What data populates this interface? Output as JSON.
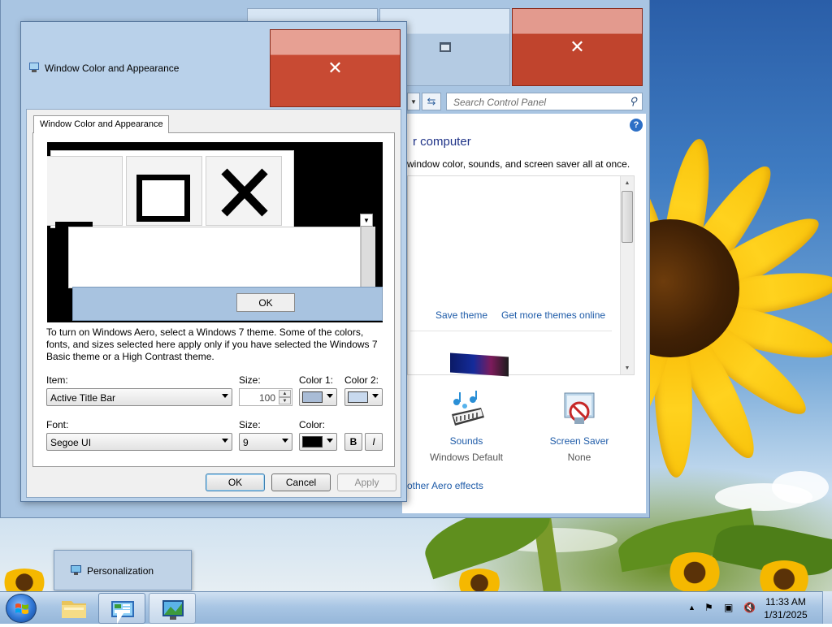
{
  "control_panel": {
    "search_placeholder": "Search Control Panel",
    "heading": "r computer",
    "description": "window color, sounds, and screen saver all at once.",
    "save_theme": "Save theme",
    "more_themes": "Get more themes online",
    "sounds_label": "Sounds",
    "sounds_value": "Windows Default",
    "screensaver_label": "Screen Saver",
    "screensaver_value": "None",
    "aero_link": "other Aero effects",
    "help": "?"
  },
  "dialog": {
    "title": "Window Color and Appearance",
    "tab": "Window Color and Appearance",
    "preview_ok": "OK",
    "info_text": "To turn on Windows Aero, select a Windows 7 theme.  Some of the colors, fonts, and sizes selected here apply only if you have selected the Windows 7 Basic theme or a High Contrast theme.",
    "item_label": "Item:",
    "item_value": "Active Title Bar",
    "size_label": "Size:",
    "size_value": "100",
    "color1_label": "Color 1:",
    "color1": "#a9bcd6",
    "color2_label": "Color 2:",
    "color2": "#c8d9ee",
    "font_label": "Font:",
    "font_value": "Segoe UI",
    "font_size_label": "Size:",
    "font_size_value": "9",
    "font_color_label": "Color:",
    "font_color": "#000000",
    "bold": "B",
    "italic": "I",
    "ok": "OK",
    "cancel": "Cancel",
    "apply": "Apply"
  },
  "taskbar": {
    "preview_label": "Personalization",
    "time": "11:33 AM",
    "date": "1/31/2025"
  }
}
